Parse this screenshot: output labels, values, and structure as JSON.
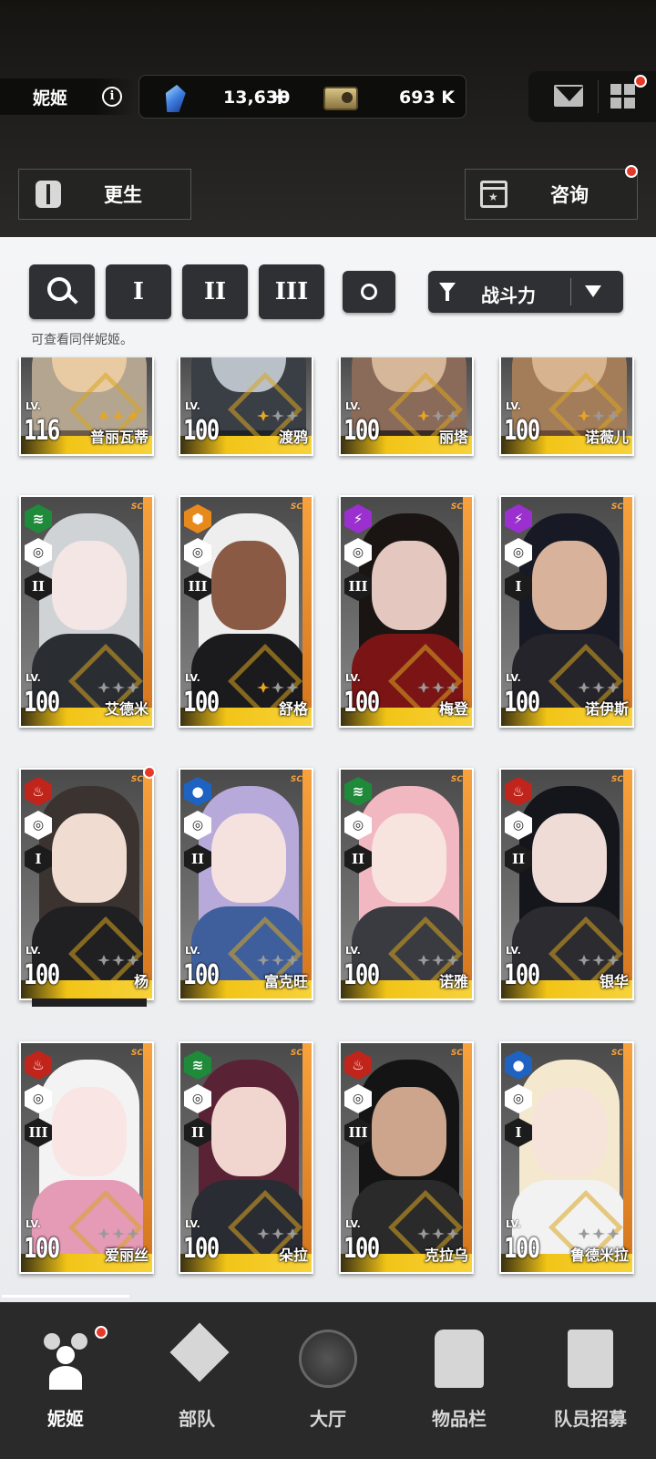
{
  "header": {
    "player_name": "妮姬",
    "gems": "13,630",
    "gems_plus": "+",
    "credits": "693 K",
    "rebirth_label": "更生",
    "consult_label": "咨询"
  },
  "filters": {
    "class_1": "I",
    "class_2": "II",
    "class_3": "III",
    "sort_label": "战斗力",
    "hint": "可查看同伴妮姬。"
  },
  "level_label": "LV.",
  "badge_text": "SC",
  "cards": [
    {
      "name": "普丽瓦蒂",
      "level": "116",
      "stars": 3
    },
    {
      "name": "渡鸦",
      "level": "100",
      "stars": 1
    },
    {
      "name": "丽塔",
      "level": "100",
      "stars": 1
    },
    {
      "name": "诺薇儿",
      "level": "100",
      "stars": 1
    },
    {
      "name": "艾德米",
      "level": "100",
      "burst": "II",
      "element": "wind",
      "stars": 0
    },
    {
      "name": "舒格",
      "level": "100",
      "burst": "III",
      "element": "iron",
      "stars": 1
    },
    {
      "name": "梅登",
      "level": "100",
      "burst": "III",
      "element": "electric",
      "stars": 0
    },
    {
      "name": "诺伊斯",
      "level": "100",
      "burst": "I",
      "element": "electric",
      "stars": 0
    },
    {
      "name": "杨",
      "level": "100",
      "burst": "I",
      "element": "fire",
      "stars": 0
    },
    {
      "name": "富克旺",
      "level": "100",
      "burst": "II",
      "element": "water",
      "stars": 0
    },
    {
      "name": "诺雅",
      "level": "100",
      "burst": "II",
      "element": "wind",
      "stars": 0
    },
    {
      "name": "银华",
      "level": "100",
      "burst": "II",
      "element": "fire",
      "stars": 0
    },
    {
      "name": "爱丽丝",
      "level": "100",
      "burst": "III",
      "element": "fire",
      "stars": 0
    },
    {
      "name": "朵拉",
      "level": "100",
      "burst": "II",
      "element": "wind",
      "stars": 0
    },
    {
      "name": "克拉乌",
      "level": "100",
      "burst": "III",
      "element": "fire",
      "stars": 0
    },
    {
      "name": "鲁德米拉",
      "level": "100",
      "burst": "I",
      "element": "water",
      "stars": 0
    }
  ],
  "element_colors": {
    "wind": "#1f8a3a",
    "iron": "#e8891c",
    "electric": "#9c2fd0",
    "fire": "#c1241a",
    "water": "#1e63c2"
  },
  "nav": {
    "nikke": "妮姬",
    "squad": "部队",
    "lobby": "大厅",
    "inventory": "物品栏",
    "recruit": "队员招募"
  }
}
